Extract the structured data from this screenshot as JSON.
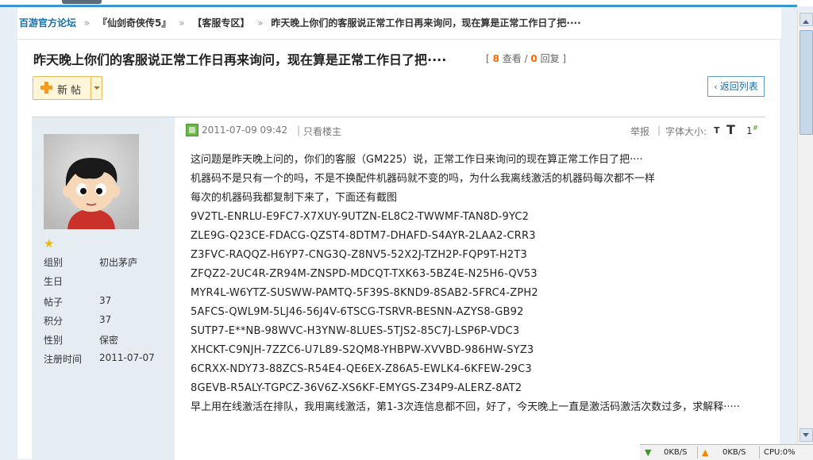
{
  "breadcrumb": {
    "home": "百游官方论坛",
    "sep": "»",
    "items": [
      "『仙剑奇侠传5』",
      "【客服专区】",
      "昨天晚上你们的客服说正常工作日再来询问，现在算是正常工作日了把····"
    ]
  },
  "thread": {
    "title": "昨天晚上你们的客服说正常工作日再来询问，现在算是正常工作日了把····",
    "views": "8",
    "views_label": "查看",
    "replies": "0",
    "replies_label": "回复"
  },
  "toolbar": {
    "new_post_label": "新帖",
    "back_label": "返回列表"
  },
  "author": {
    "fields": [
      {
        "k": "组别",
        "v": "初出茅庐"
      },
      {
        "k": "生日",
        "v": ""
      },
      {
        "k": "帖子",
        "v": "37"
      },
      {
        "k": "积分",
        "v": "37"
      },
      {
        "k": "性别",
        "v": "保密"
      },
      {
        "k": "注册时间",
        "v": "2011-07-07"
      }
    ]
  },
  "post": {
    "date": "2011-07-09 09:42",
    "only_op": "只看楼主",
    "report": "举报",
    "font_size_label": "字体大小:",
    "font_small": "T",
    "font_big": "T",
    "floor": "1",
    "floor_sup": "#",
    "lines": [
      "这问题是昨天晚上问的，你们的客服（GM225）说，正常工作日来询问的现在算正常工作日了把····",
      "机器码不是只有一个的吗，不是不换配件机器码就不变的吗，为什么我离线激活的机器码每次都不一样",
      "每次的机器码我都复制下来了，下面还有截图"
    ],
    "codes": [
      "9V2TL-ENRLU-E9FC7-X7XUY-9UTZN-EL8C2-TWWMF-TAN8D-9YC2",
      "ZLE9G-Q23CE-FDACG-QZST4-8DTM7-DHAFD-S4AYR-2LAA2-CRR3",
      "Z3FVC-RAQQZ-H6YP7-CNG3Q-Z8NV5-52X2J-TZH2P-FQP9T-H2T3",
      "ZFQZ2-2UC4R-ZR94M-ZNSPD-MDCQT-TXK63-5BZ4E-N25H6-QV53",
      "MYR4L-W6YTZ-SUSWW-PAMTQ-5F39S-8KND9-8SAB2-5FRC4-ZPH2",
      "5AFCS-QWL9M-5LJ46-56J4V-6TSCG-TSRVR-BESNN-AZYS8-GB92",
      "SUTP7-E**NB-98WVC-H3YNW-8LUES-5TJS2-85C7J-LSP6P-VDC3",
      "XHCKT-C9NJH-7ZZC6-U7L89-S2QM8-YHBPW-XVVBD-986HW-SYZ3",
      "6CRXX-NDY73-88ZCS-R54E4-QE6EX-Z86A5-EWLK4-6KFEW-29C3",
      "8GEVB-R5ALY-TGPCZ-36V6Z-XS6KF-EMYGS-Z34P9-ALERZ-8AT2"
    ],
    "ending": "早上用在线激活在排队，我用离线激活，第1-3次连信息都不回，好了，今天晚上一直是激活码激活次数过多，求解释·····"
  },
  "statusbar": {
    "download": "0KB/S",
    "upload": "0KB/S",
    "cpu": "CPU:0%"
  }
}
